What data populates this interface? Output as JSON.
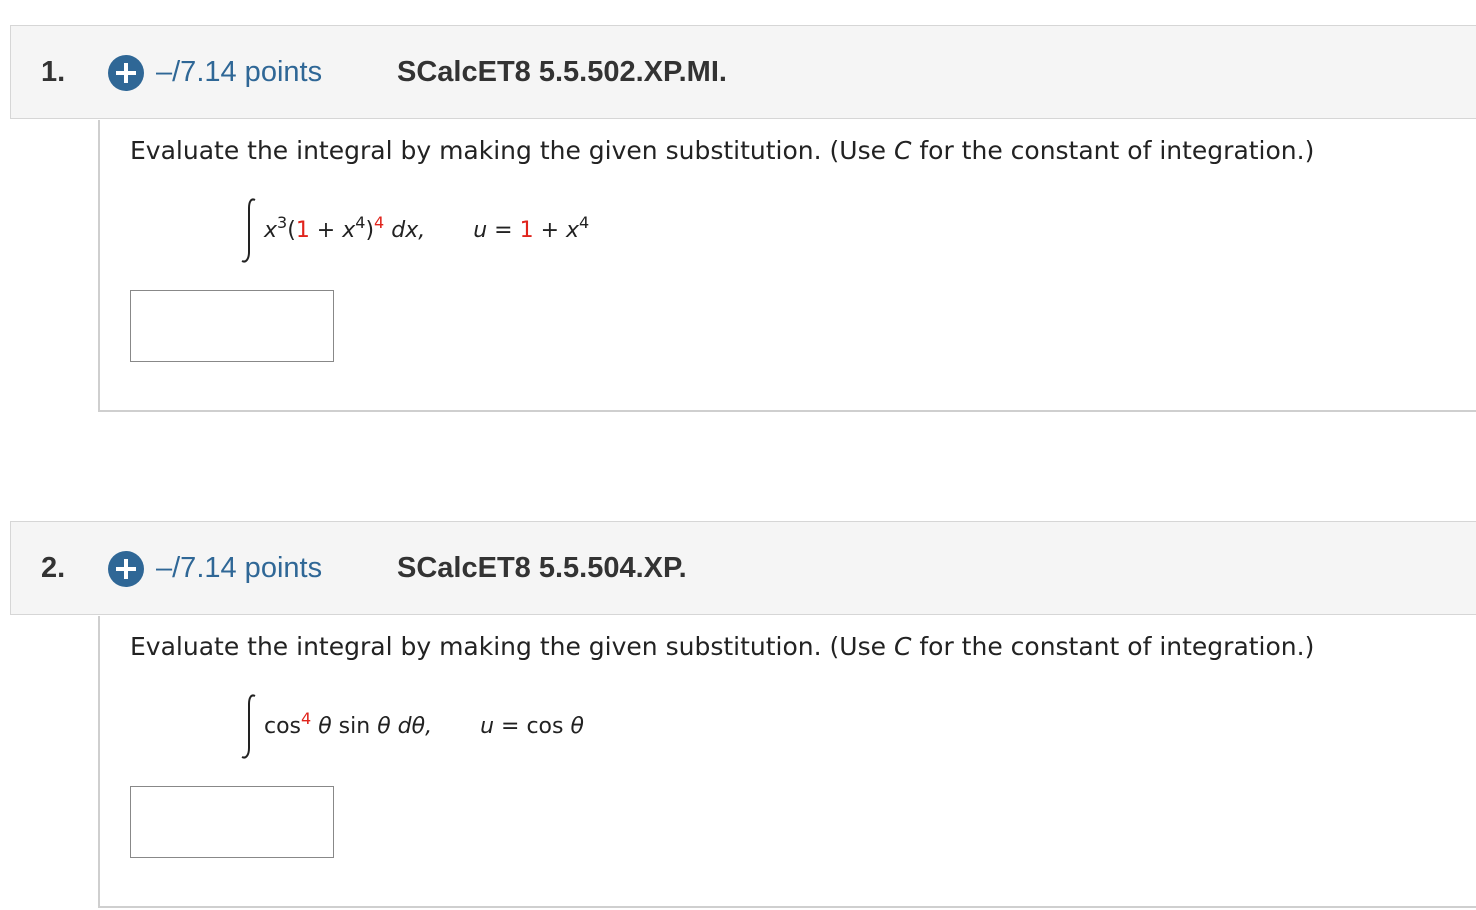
{
  "questions": [
    {
      "number": "1.",
      "points": "–/7.14 points",
      "code": "SCalcET8 5.5.502.XP.MI.",
      "instruction_pre": "Evaluate the integral by making the given substitution. (Use ",
      "instruction_var": "C",
      "instruction_post": " for the constant of integration.)",
      "integrand": {
        "x1": "x",
        "exp1": "3",
        "open": "(",
        "one": "1",
        "plus": " + ",
        "x2": "x",
        "exp2": "4",
        "close": ")",
        "exp3": "4",
        "dx": " dx,"
      },
      "substitution": {
        "u": "u",
        "eq": " = ",
        "one": "1",
        "plus": " + ",
        "x": "x",
        "exp": "4"
      },
      "answer_value": ""
    },
    {
      "number": "2.",
      "points": "–/7.14 points",
      "code": "SCalcET8 5.5.504.XP.",
      "instruction_pre": "Evaluate the integral by making the given substitution. (Use ",
      "instruction_var": "C",
      "instruction_post": " for the constant of integration.)",
      "integrand": {
        "cos": "cos",
        "exp": "4",
        "theta1": " θ",
        "sin": " sin ",
        "theta2": "θ",
        "dtheta": " dθ,"
      },
      "substitution": {
        "u": "u",
        "eq": " = cos ",
        "theta": "θ"
      },
      "answer_value": ""
    }
  ],
  "colors": {
    "accent_blue": "#2f6796",
    "highlight_red": "#e0241c",
    "header_bg": "#f5f5f5"
  },
  "icons": [
    "plus-circle-icon",
    "integral-sign-icon"
  ]
}
